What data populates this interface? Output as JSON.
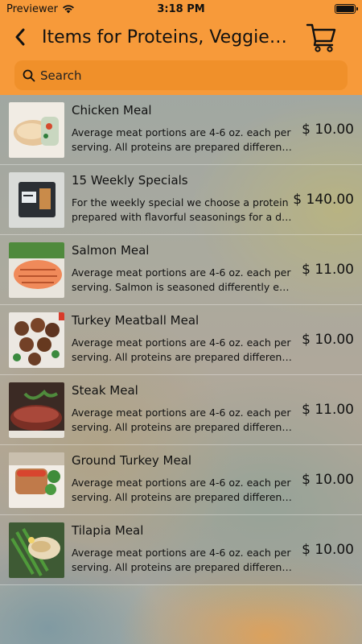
{
  "status_bar": {
    "carrier": "Previewer",
    "time": "3:18 PM"
  },
  "nav": {
    "title": "Items for Proteins, Veggies &...",
    "back_icon": "chevron-left-icon",
    "cart_icon": "shopping-cart-icon"
  },
  "search": {
    "placeholder": "Search",
    "value": ""
  },
  "items": [
    {
      "name": "Chicken Meal",
      "desc_line1": "Average meat portions are 4-6 oz. each per",
      "desc_line2": "serving. All proteins are prepared different...",
      "price": "$ 10.00"
    },
    {
      "name": "15 Weekly Specials",
      "desc_line1": "For the weekly special we choose a protein",
      "desc_line2": "prepared with flavorful seasonings for a del...",
      "price": "$ 140.00"
    },
    {
      "name": "Salmon Meal",
      "desc_line1": "Average meat portions are 4-6 oz. each per",
      "desc_line2": "serving. Salmon is seasoned differently eac...",
      "price": "$ 11.00"
    },
    {
      "name": "Turkey Meatball Meal",
      "desc_line1": "Average meat portions are 4-6 oz. each per",
      "desc_line2": "serving. All proteins are prepared different...",
      "price": "$ 10.00"
    },
    {
      "name": "Steak Meal",
      "desc_line1": "Average meat portions are 4-6 oz. each per",
      "desc_line2": "serving. All proteins are prepared different...",
      "price": "$ 11.00"
    },
    {
      "name": "Ground Turkey Meal",
      "desc_line1": "Average meat portions are 4-6 oz. each per",
      "desc_line2": "serving. All proteins are prepared different...",
      "price": "$ 10.00"
    },
    {
      "name": "Tilapia Meal",
      "desc_line1": "Average meat portions are 4-6 oz. each per",
      "desc_line2": "serving. All proteins are prepared different...",
      "price": "$ 10.00"
    }
  ],
  "colors": {
    "header": "#f79a3a",
    "search_bg": "#f0902a"
  }
}
